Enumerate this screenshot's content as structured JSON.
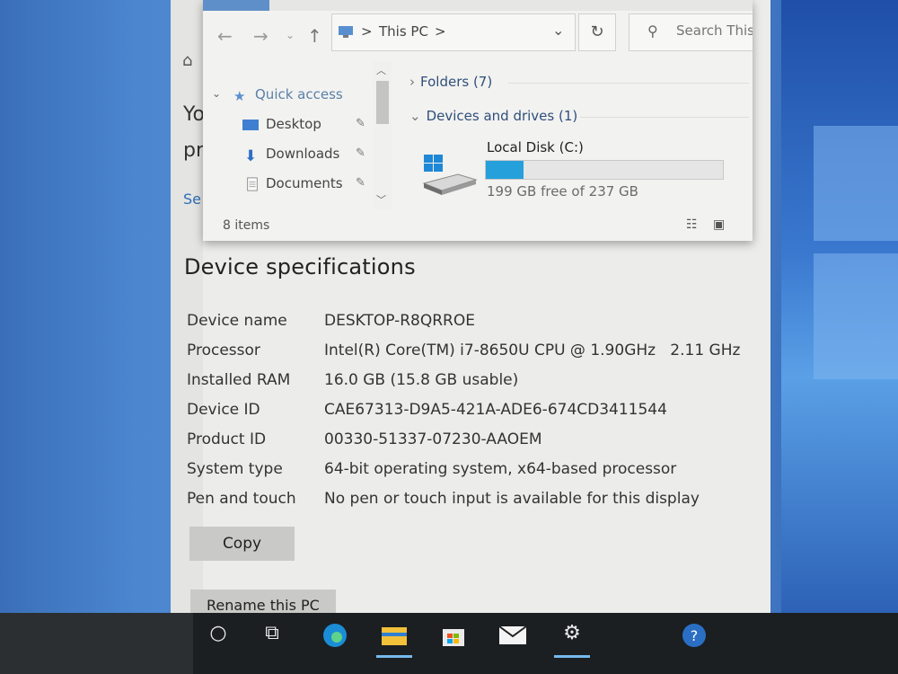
{
  "explorer": {
    "address": {
      "crumb_root_sep": ">",
      "location": "This PC",
      "crumb_after_sep": ">"
    },
    "search_placeholder": "Search This PC",
    "nav": {
      "quick_access": "Quick access",
      "items": [
        {
          "label": "Desktop"
        },
        {
          "label": "Downloads"
        },
        {
          "label": "Documents"
        }
      ]
    },
    "groups": {
      "folders": "Folders (7)",
      "devices": "Devices and drives (1)"
    },
    "drive": {
      "name": "Local Disk (C:)",
      "free_text": "199 GB free of 237 GB",
      "used_fraction": 0.16
    },
    "status": {
      "item_count": "8 items"
    }
  },
  "settings": {
    "partial": {
      "line1": "Yo",
      "line2": "pr",
      "link": "Se"
    },
    "spec_title": "Device specifications",
    "specs": [
      {
        "label": "Device name",
        "value": "DESKTOP-R8QRROE"
      },
      {
        "label": "Processor",
        "value": "Intel(R) Core(TM) i7-8650U CPU @ 1.90GHz   2.11 GHz"
      },
      {
        "label": "Installed RAM",
        "value": "16.0 GB (15.8 GB usable)"
      },
      {
        "label": "Device ID",
        "value": "CAE67313-D9A5-421A-ADE6-674CD3411544"
      },
      {
        "label": "Product ID",
        "value": "00330-51337-07230-AAOEM"
      },
      {
        "label": "System type",
        "value": "64-bit operating system, x64-based processor"
      },
      {
        "label": "Pen and touch",
        "value": "No pen or touch input is available for this display"
      }
    ],
    "copy_label": "Copy",
    "rename_label": "Rename this PC"
  },
  "taskbar": {
    "items": [
      {
        "icon": "cortana-circle-icon"
      },
      {
        "icon": "task-view-icon"
      },
      {
        "icon": "edge-icon"
      },
      {
        "icon": "file-explorer-icon",
        "active": true
      },
      {
        "icon": "microsoft-store-icon"
      },
      {
        "icon": "mail-icon"
      },
      {
        "icon": "settings-gear-icon",
        "active": true
      },
      {
        "icon": "help-icon"
      }
    ]
  },
  "colors": {
    "accent": "#26a0da",
    "taskbar": "#1b1f22",
    "link": "#2d6db5"
  }
}
